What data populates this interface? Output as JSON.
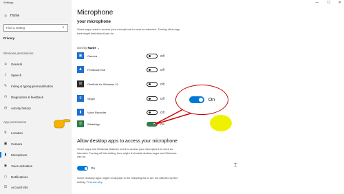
{
  "window": {
    "title": "Settings",
    "controls": [
      "—",
      "☐",
      "✕"
    ]
  },
  "sidebar": {
    "home_label": "Home",
    "search_placeholder": "Find a setting",
    "category": "Privacy",
    "windows_permissions_label": "Windows permissions",
    "windows_items": [
      {
        "label": "General",
        "icon": "lock-icon"
      },
      {
        "label": "Speech",
        "icon": "speech-icon"
      },
      {
        "label": "Inking & typing personalization",
        "icon": "inking-icon"
      },
      {
        "label": "Diagnostics & feedback",
        "icon": "diagnostics-icon"
      },
      {
        "label": "Activity history",
        "icon": "history-icon"
      }
    ],
    "app_permissions_label": "App permissions",
    "app_items": [
      {
        "label": "Location",
        "icon": "location-icon"
      },
      {
        "label": "Camera",
        "icon": "camera-icon"
      },
      {
        "label": "Microphone",
        "icon": "microphone-icon",
        "active": true
      },
      {
        "label": "Voice activation",
        "icon": "voice-activation-icon"
      },
      {
        "label": "Notifications",
        "icon": "notifications-icon"
      },
      {
        "label": "Account info",
        "icon": "account-info-icon"
      }
    ]
  },
  "main": {
    "title": "Microphone",
    "subtitle": "your microphone",
    "description": "Some apps need to access your microphone to work as intended. Turning off an app here might limit what it can do.",
    "sort_by_label": "Sort by",
    "sort_by_value": "Name",
    "apps": [
      {
        "name": "Camera",
        "state": "Off",
        "on": false,
        "color": "#1f6fd0",
        "icon": "camera-app-icon"
      },
      {
        "name": "Feedback Hub",
        "state": "Off",
        "on": false,
        "color": "#1f6fd0",
        "icon": "feedback-hub-icon"
      },
      {
        "name": "OneNote for Windows 10",
        "state": "Off",
        "on": false,
        "color": "#2b2b2b",
        "icon": "onenote-icon"
      },
      {
        "name": "Skype",
        "state": "Off",
        "on": false,
        "color": "#1f6fd0",
        "icon": "skype-icon"
      },
      {
        "name": "Voice Recorder",
        "state": "Off",
        "on": false,
        "color": "#1f6fd0",
        "icon": "voice-recorder-icon"
      },
      {
        "name": "WhatsApp",
        "state": "On",
        "on": true,
        "color": "#2e7d4f",
        "icon": "whatsapp-icon"
      }
    ],
    "desktop_section_title": "Allow desktop apps to access your microphone",
    "desktop_section_desc": "Some apps and Windows features need to access your microphone to work as intended. Turning off this setting here might limit what desktop apps and Windows can do.",
    "desktop_toggle_state": "On",
    "desktop_note": "Some desktop apps might not appear in the following list or are not affected by this setting.",
    "desktop_note_link": "Find out why"
  },
  "callout": {
    "label": "On"
  },
  "colors": {
    "accent": "#0078d7",
    "highlight": "#eef200",
    "callout_border": "#cc0000"
  }
}
